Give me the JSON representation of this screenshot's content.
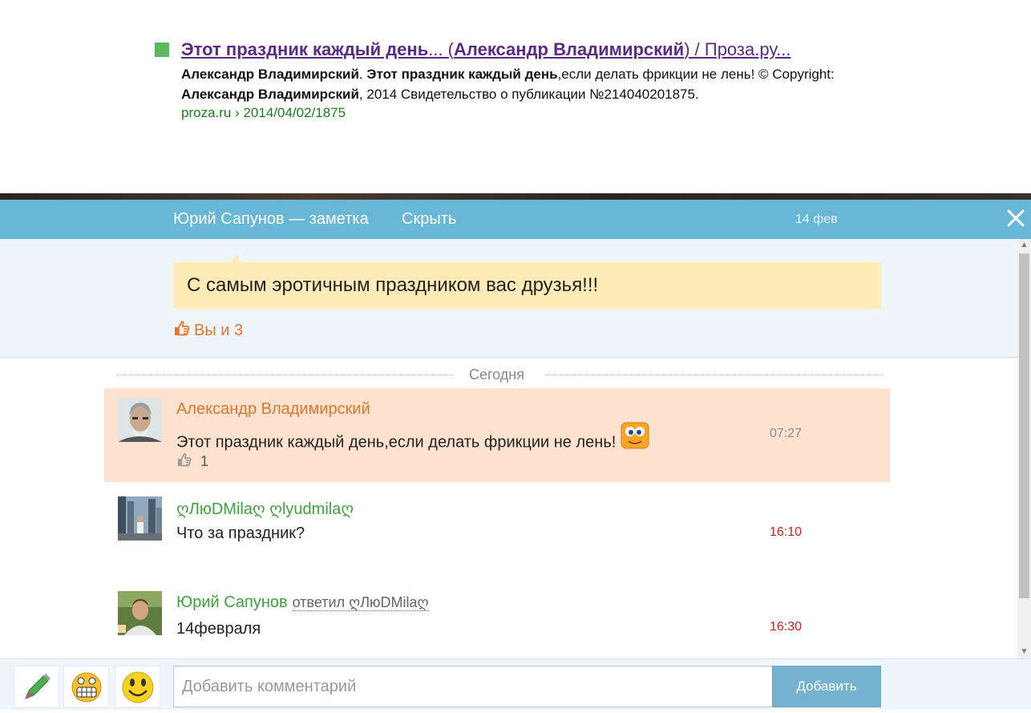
{
  "search_result": {
    "title_bold1": "Этот праздник каждый день",
    "title_mid": "... (",
    "title_bold2": "Александр Владимирский",
    "title_end": ") / Проза.ру...",
    "snippet_b1": "Александр Владимирский",
    "snippet_t1": ". ",
    "snippet_b2": "Этот праздник каждый день",
    "snippet_t2": ",если делать фрикции не лень! © Copyright: ",
    "snippet_b3": "Александр Владимирский",
    "snippet_t3": ", 2014 Свидетельство о публикации №214040201875.",
    "url": "proza.ru › 2014/04/02/1875",
    "bullet_color": "#5cb85c"
  },
  "header": {
    "author": "Юрий Сапунов — заметка",
    "hide_label": "Скрыть",
    "date": "14 фев",
    "close_icon": "close-icon",
    "bg_color": "#68b7d6"
  },
  "post": {
    "text": "С самым эротичным праздником вас друзья!!!",
    "likes_label": "Вы и 3"
  },
  "comments": {
    "divider_label": "Сегодня",
    "items": [
      {
        "author": "Александр Владимирский",
        "text": "Этот праздник каждый день,если делать фрикции не лень!",
        "time": "07:27",
        "likes": "1",
        "author_color": "#e0772a"
      },
      {
        "author": "ღЛюDМilaღ ღlyudmilaღ",
        "text": "Что за праздник?",
        "time": "16:10",
        "author_color": "#3aa43a"
      },
      {
        "author": "Юрий Сапунов",
        "reply_to": "ответил ღЛюDМilaღ",
        "text": "14февраля",
        "time": "16:30",
        "author_color": "#3aa43a"
      }
    ]
  },
  "footer": {
    "placeholder": "Добавить комментарий",
    "add_label": "Добавить"
  }
}
